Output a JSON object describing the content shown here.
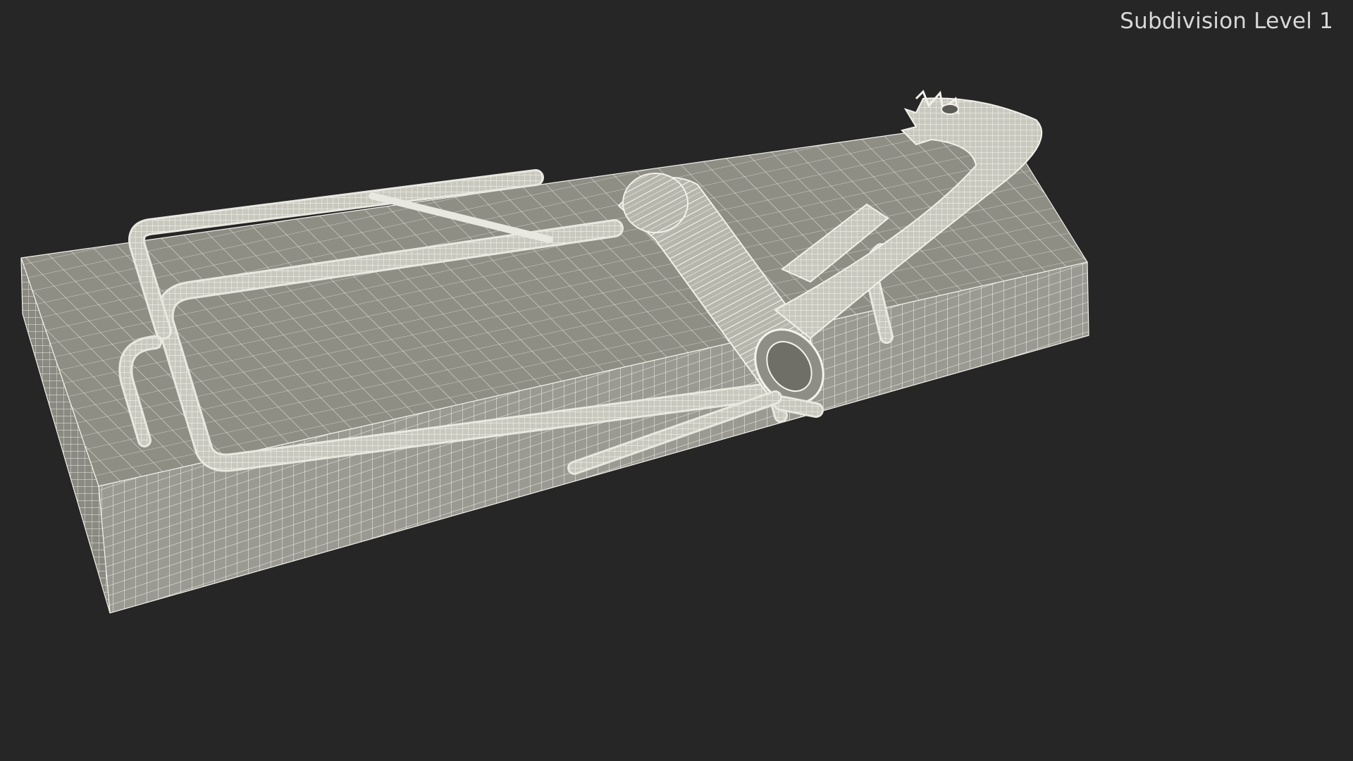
{
  "overlay": {
    "subdivision_label": "Subdivision Level 1"
  },
  "scene": {
    "subject": "mousetrap-wireframe-model",
    "background_color": "#262626",
    "surface_color": "#8b8b82",
    "wire_color": "#f2f1ea"
  }
}
